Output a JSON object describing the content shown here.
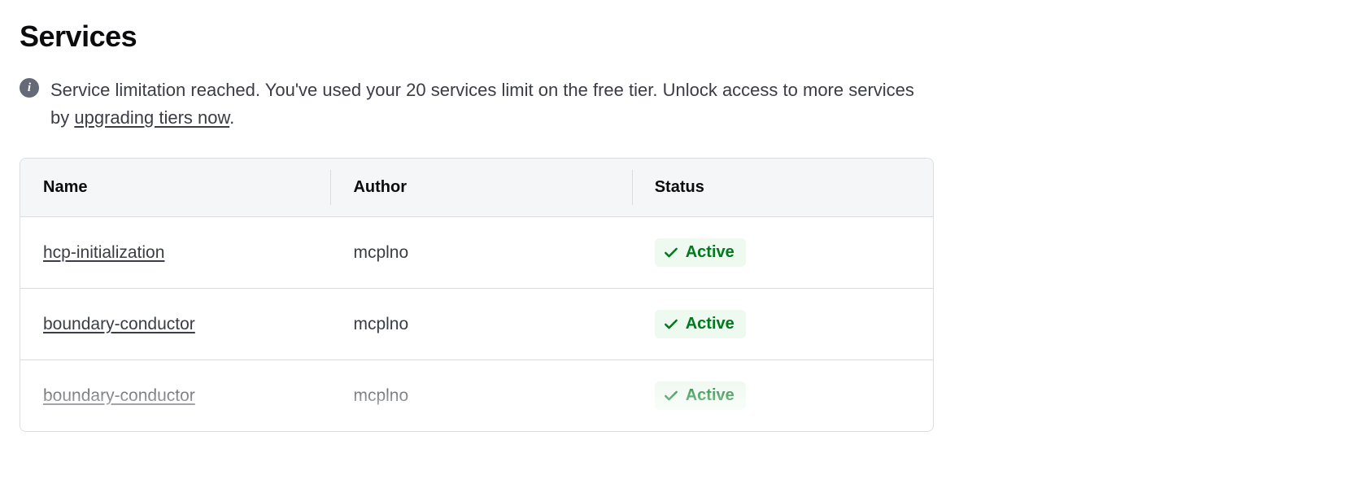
{
  "header": {
    "title": "Services"
  },
  "alert": {
    "text_before_link": "Service limitation reached. You've used your 20 services limit on the free tier. Unlock access to more services by ",
    "link_text": "upgrading tiers now",
    "text_after_link": "."
  },
  "table": {
    "headers": {
      "name": "Name",
      "author": "Author",
      "status": "Status"
    },
    "rows": [
      {
        "name": "hcp-initialization",
        "author": "mcplno",
        "status": "Active"
      },
      {
        "name": "boundary-conductor",
        "author": "mcplno",
        "status": "Active"
      },
      {
        "name": "boundary-conductor",
        "author": "mcplno",
        "status": "Active"
      }
    ]
  }
}
